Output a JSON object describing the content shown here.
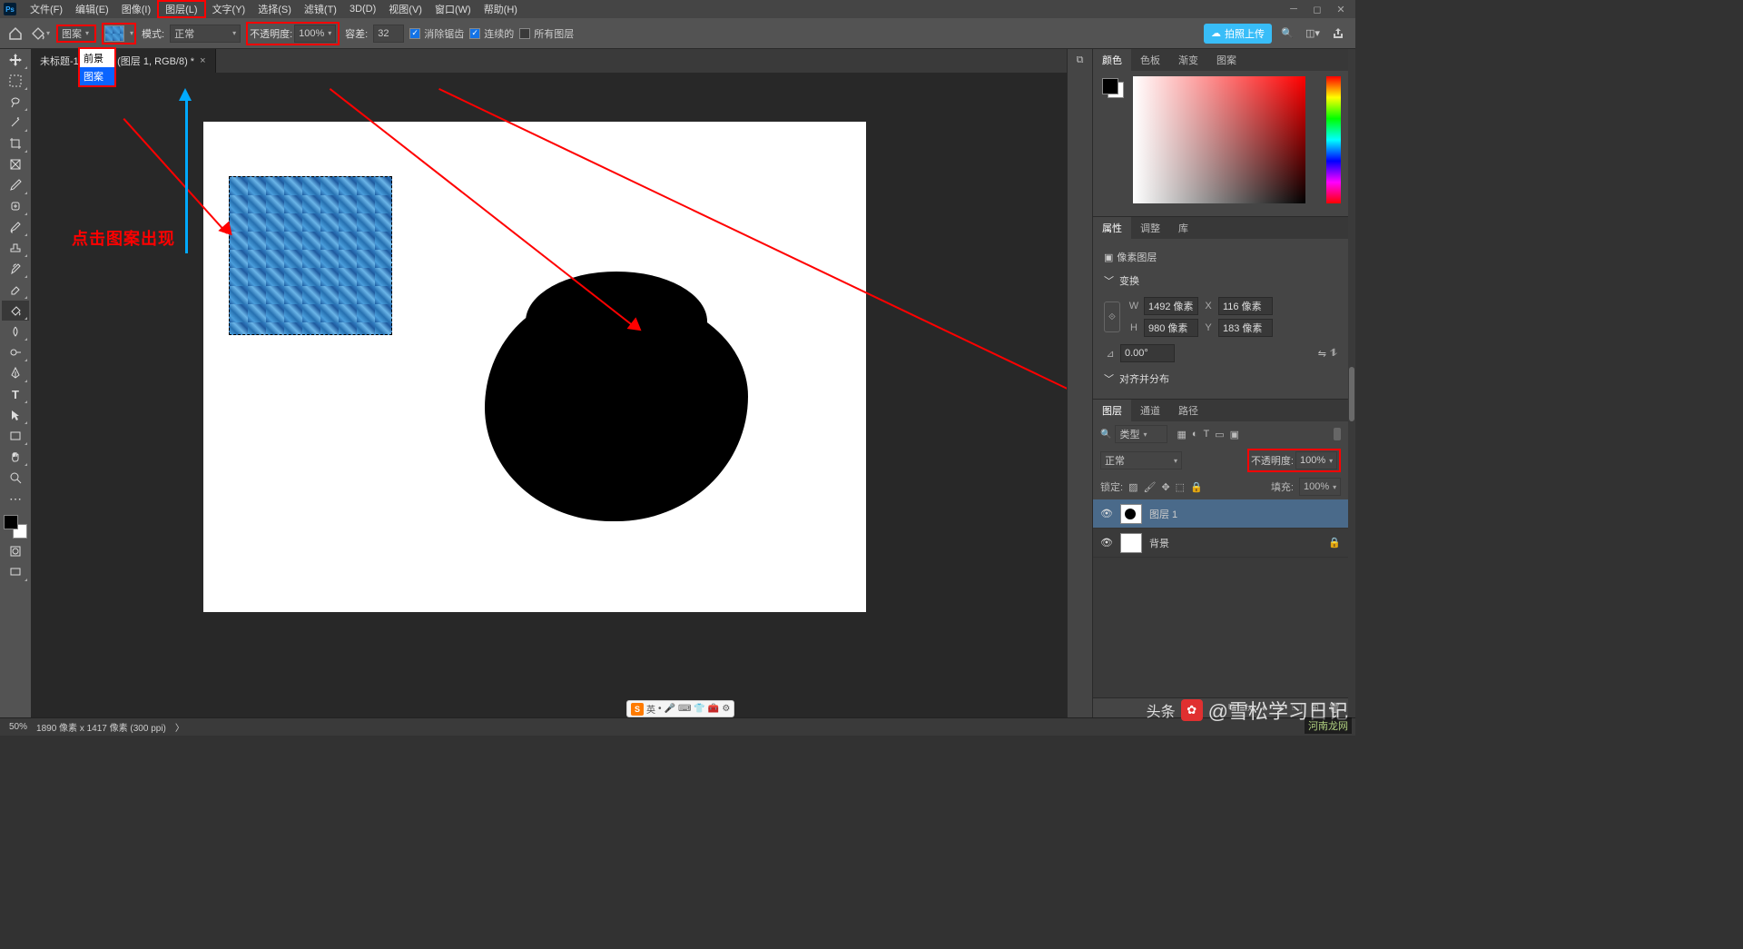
{
  "menu": {
    "items": [
      "文件(F)",
      "编辑(E)",
      "图像(I)",
      "图层(L)",
      "文字(Y)",
      "选择(S)",
      "滤镜(T)",
      "3D(D)",
      "视图(V)",
      "窗口(W)",
      "帮助(H)"
    ]
  },
  "optbar": {
    "fill_dropdown": "图案",
    "fill_options": [
      "前景",
      "图案"
    ],
    "mode_label": "模式:",
    "mode_value": "正常",
    "opacity_label": "不透明度:",
    "opacity_value": "100%",
    "tolerance_label": "容差:",
    "tolerance_value": "32",
    "antialias": "消除锯齿",
    "contiguous": "连续的",
    "all_layers": "所有图层",
    "upload_btn": "拍照上传"
  },
  "tab": {
    "title": "未标题-1 @ 50% (图层 1, RGB/8) *"
  },
  "annotation": "点击图案出现",
  "panels": {
    "color_tabs": [
      "颜色",
      "色板",
      "渐变",
      "图案"
    ],
    "props_tabs": [
      "属性",
      "调整",
      "库"
    ],
    "props_title": "像素图层",
    "transform_hdr": "变换",
    "W": "1492 像素",
    "H": "980 像素",
    "X": "116 像素",
    "Y": "183 像素",
    "angle": "0.00°",
    "align_hdr": "对齐并分布",
    "layer_tabs": [
      "图层",
      "通道",
      "路径"
    ],
    "filter_label": "类型",
    "blend": "正常",
    "opacity_label": "不透明度:",
    "opacity_value": "100%",
    "lock_label": "锁定:",
    "fill_label": "填充:",
    "fill_value": "100%",
    "layers": [
      {
        "name": "图层 1"
      },
      {
        "name": "背景"
      }
    ]
  },
  "status": {
    "zoom": "50%",
    "dims": "1890 像素 x 1417 像素 (300 ppi)"
  },
  "ime": {
    "lang": "英"
  },
  "watermark": {
    "main": "@雪松学习日记",
    "small": "河南龙网"
  }
}
